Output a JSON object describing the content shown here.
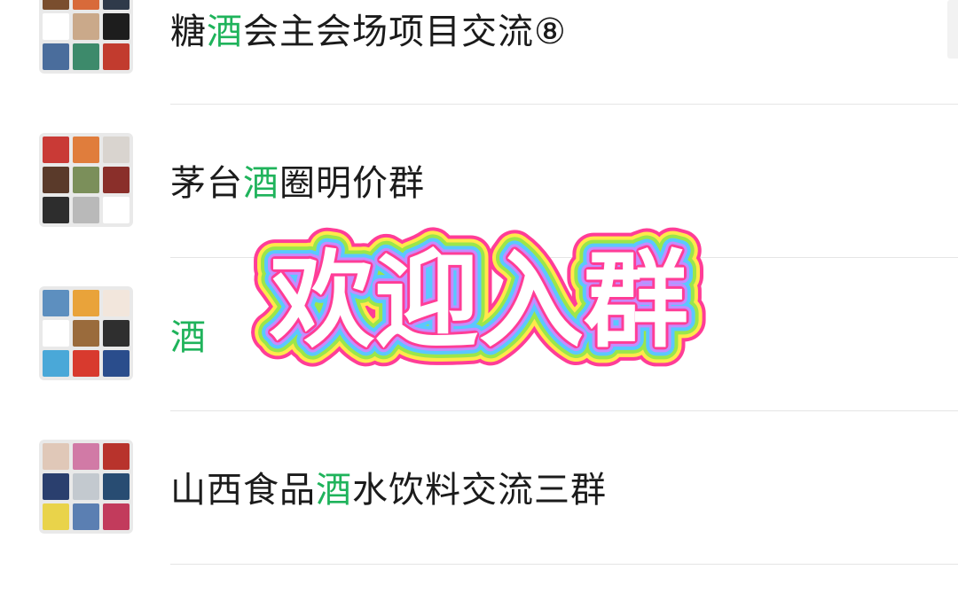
{
  "chats": [
    {
      "before": "糖",
      "keyword": "酒",
      "after": "会主会场项目交流⑧",
      "tiles": [
        "#7a4e2e",
        "#d86a3a",
        "#2f3a4a",
        "#ffffff",
        "#caa98a",
        "#1d1d1d",
        "#4a6d9c",
        "#3d8a6b",
        "#c23b2e"
      ]
    },
    {
      "before": "茅台",
      "keyword": "酒",
      "after": "圈明价群",
      "tiles": [
        "#c93a36",
        "#e07d3c",
        "#d9d4cf",
        "#5a3a2a",
        "#7b8f5a",
        "#8a2f2a",
        "#2d2d2d",
        "#b9b9b9",
        "#ffffff"
      ]
    },
    {
      "before": "",
      "keyword": "酒",
      "after": "",
      "tiles": [
        "#5d8fbf",
        "#e9a33a",
        "#f2e6dc",
        "#ffffff",
        "#9a6b3c",
        "#2f2f2f",
        "#4aa8d8",
        "#d83a2e",
        "#2a4d8c"
      ]
    },
    {
      "before": "山西食品",
      "keyword": "酒",
      "after": "水饮料交流三群",
      "tiles": [
        "#e0c8b8",
        "#d17aa6",
        "#b8332c",
        "#2a3f6e",
        "#c3c9cf",
        "#284c72",
        "#e9d34a",
        "#5b7fb2",
        "#c23b5c"
      ]
    }
  ],
  "overlay": {
    "text": "欢迎入群",
    "fill": "#ffffff",
    "stroke_colors": [
      "#ff3d97",
      "#ffe94a",
      "#9be64a",
      "#5ac8ff",
      "#c48cff",
      "#ff3d97"
    ]
  },
  "colors": {
    "keyword": "#1fb35b",
    "title": "#1b1b1b",
    "divider": "#e5e5e5"
  }
}
